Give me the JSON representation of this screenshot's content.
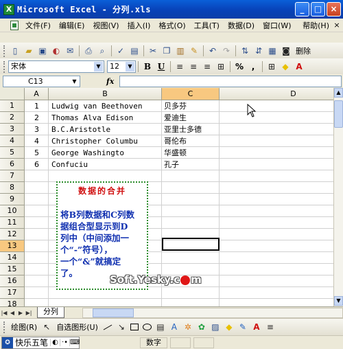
{
  "window": {
    "title": "Microsoft Excel - 分列.xls",
    "app_icon": "X",
    "buttons": [
      "_",
      "□",
      "×"
    ]
  },
  "menu": {
    "items": [
      "文件(F)",
      "编辑(E)",
      "视图(V)",
      "插入(I)",
      "格式(O)",
      "工具(T)",
      "数据(D)",
      "窗口(W)"
    ],
    "help": "帮助(H)",
    "close": "×"
  },
  "toolbar": {
    "delete_label": "删除",
    "font_name": "宋体",
    "font_size": "12",
    "bold": "B",
    "underline": "U",
    "percent": "%",
    "comma": ","
  },
  "formula_bar": {
    "name_box": "C13",
    "fx": "fx",
    "formula": ""
  },
  "grid": {
    "columns": [
      "A",
      "B",
      "C",
      "D"
    ],
    "active_column": "C",
    "rows": [
      "1",
      "2",
      "3",
      "4",
      "5",
      "6",
      "7",
      "8",
      "9",
      "10",
      "11",
      "12",
      "13",
      "14",
      "15",
      "16",
      "17",
      "18"
    ],
    "active_row": "13",
    "data": [
      {
        "a": "1",
        "b": "Ludwig van Beethoven",
        "c": "贝多芬"
      },
      {
        "a": "2",
        "b": "Thomas Alva Edison",
        "c": "爱迪生"
      },
      {
        "a": "3",
        "b": "B.C.Aristotle",
        "c": "亚里士多德"
      },
      {
        "a": "4",
        "b": "Christopher Columbu",
        "c": "哥伦布"
      },
      {
        "a": "5",
        "b": "George Washingto",
        "c": "华盛顿"
      },
      {
        "a": "6",
        "b": "Confuciu",
        "c": "孔子"
      }
    ]
  },
  "note": {
    "title": "数据的合并",
    "lines": [
      "将B列数据和C列数",
      "据组合型显示到D",
      "列中（中间添加一",
      "个“-”符号），",
      "一个“&”就搞定",
      "了。"
    ]
  },
  "watermark": {
    "prefix": "Soft.Yesky.c",
    "suffix": "m"
  },
  "sheet_tabs": {
    "active": "分列"
  },
  "drawing_toolbar": {
    "draw_label": "绘图(R)",
    "autoshape_label": "自选图形(U)"
  },
  "status": {
    "ime_name": "快乐五笔",
    "mode": "数字"
  },
  "colors": {
    "title_bar": "#0a4fc8",
    "note_title": "#d01010",
    "note_text": "#1030b0",
    "note_border": "#2a8c2a",
    "active_header": "#f8c880"
  }
}
